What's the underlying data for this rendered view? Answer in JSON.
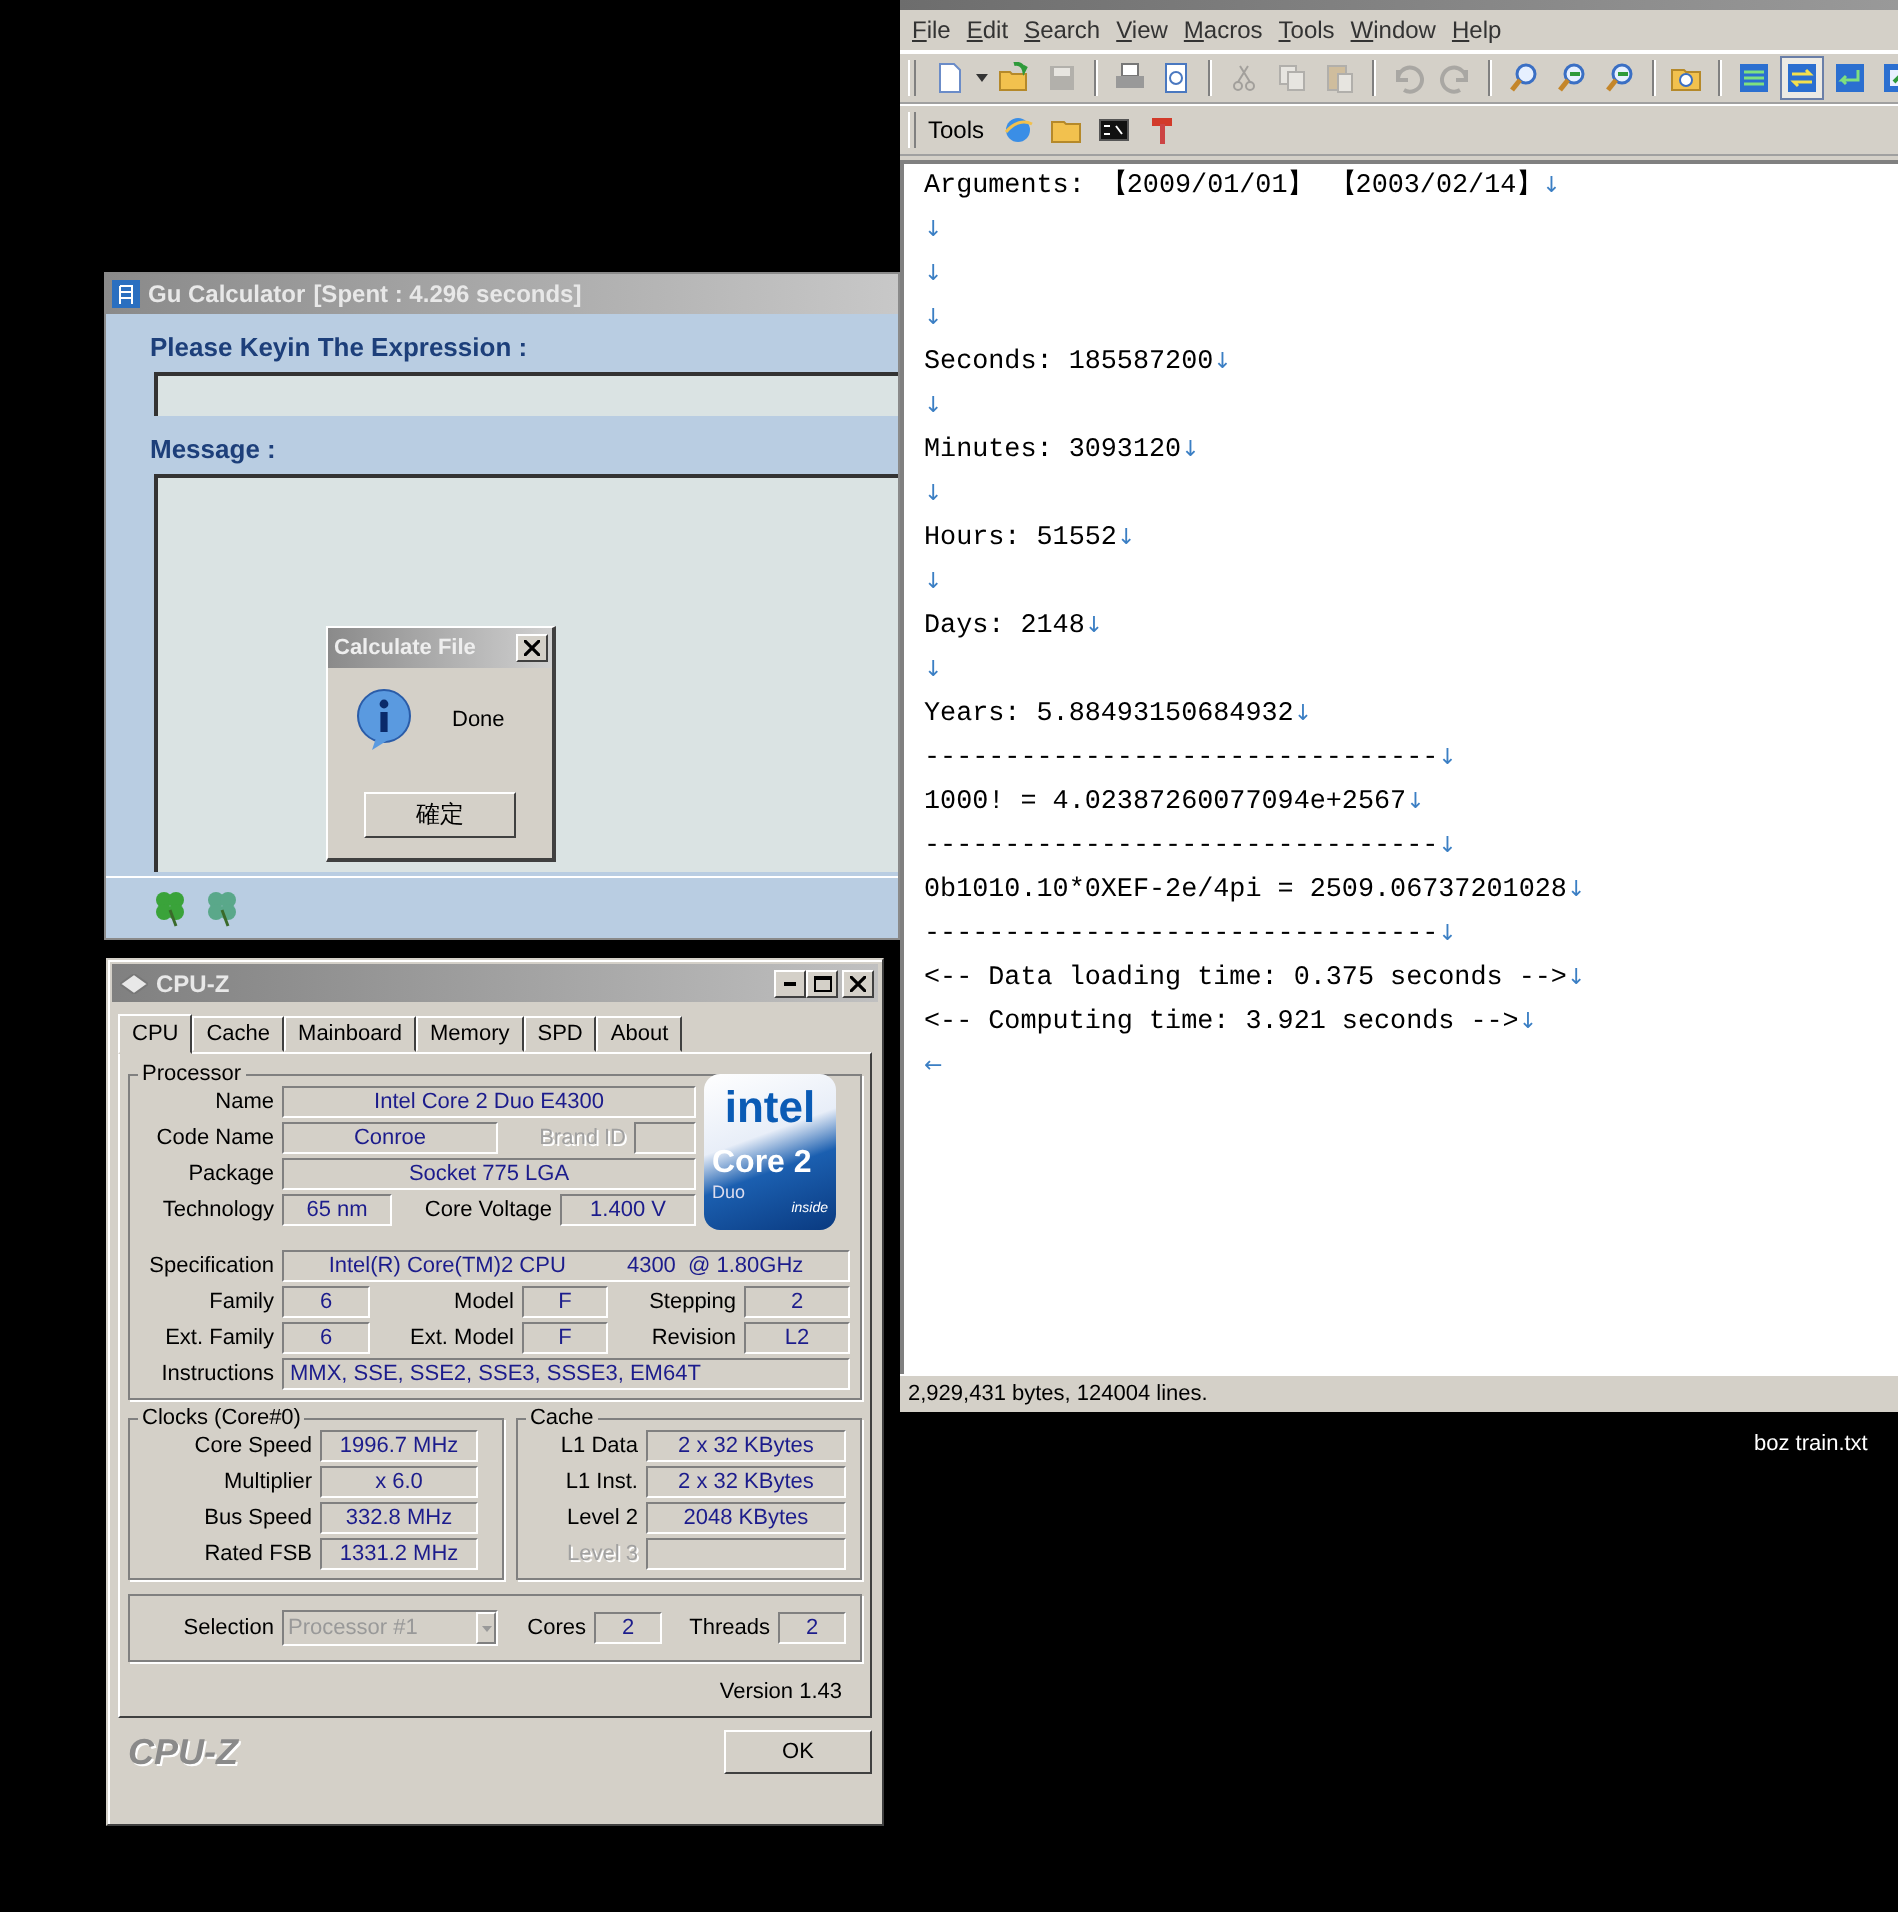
{
  "editor": {
    "menu": [
      "File",
      "Edit",
      "Search",
      "View",
      "Macros",
      "Tools",
      "Window",
      "Help"
    ],
    "toolbar": [
      {
        "pressed": false,
        "disabled": false
      },
      {
        "pressed": false,
        "disabled": false
      },
      {
        "pressed": false,
        "disabled": true
      },
      {
        "pressed": false,
        "disabled": false
      },
      {
        "pressed": false,
        "disabled": false
      },
      {
        "pressed": false,
        "disabled": true
      },
      {
        "pressed": false,
        "disabled": true
      },
      {
        "pressed": false,
        "disabled": true
      },
      {
        "pressed": false,
        "disabled": true
      },
      {
        "pressed": false,
        "disabled": true
      },
      {
        "pressed": false,
        "disabled": false
      },
      {
        "pressed": false,
        "disabled": false
      },
      {
        "pressed": false,
        "disabled": false
      },
      {
        "pressed": false,
        "disabled": false
      },
      {
        "pressed": false,
        "disabled": false
      },
      {
        "pressed": true,
        "disabled": false
      },
      {
        "pressed": false,
        "disabled": false
      },
      {
        "pressed": false,
        "disabled": false
      }
    ],
    "tools_label": "Tools",
    "lines": [
      {
        "text": "Arguments: 【2009/01/01】 【2003/02/14】",
        "end": "↓"
      },
      {
        "end": "↓"
      },
      {
        "end": "↓"
      },
      {
        "end": "↓"
      },
      {
        "text": "Seconds: 185587200",
        "end": "↓"
      },
      {
        "end": "↓"
      },
      {
        "text": "Minutes: 3093120",
        "end": "↓"
      },
      {
        "end": "↓"
      },
      {
        "text": "Hours: 51552",
        "end": "↓"
      },
      {
        "end": "↓"
      },
      {
        "text": "Days: 2148",
        "end": "↓"
      },
      {
        "end": "↓"
      },
      {
        "text": "Years: 5.88493150684932",
        "end": "↓"
      },
      {
        "text": "--------------------------------",
        "end": "↓"
      },
      {
        "text": "1000! = 4.02387260077094e+2567",
        "end": "↓"
      },
      {
        "text": "--------------------------------",
        "end": "↓"
      },
      {
        "text": "0b1010.10*0XEF-2e/4pi = 2509.06737201028",
        "end": "↓"
      },
      {
        "text": "--------------------------------",
        "end": "↓"
      },
      {
        "text": "<-- Data loading time: 0.375 seconds -->",
        "end": "↓"
      },
      {
        "text": "<-- Computing time: 3.921 seconds -->",
        "end": "↓"
      },
      {
        "end": "←"
      }
    ],
    "status": "2,929,431 bytes, 124004 lines."
  },
  "desktop_icon": {
    "label": "boz train.txt"
  },
  "gu_calculator": {
    "title": "Gu Calculator",
    "spent": "[Spent : 4.296 seconds]",
    "expression_label": "Please Keyin The Expression :",
    "message_label": "Message :"
  },
  "dialog": {
    "title": "Calculate File",
    "message": "Done",
    "button": "確定"
  },
  "cpuz": {
    "title": "CPU-Z",
    "tabs": [
      {
        "label": "CPU",
        "selected": true
      },
      {
        "label": "Cache",
        "selected": false
      },
      {
        "label": "Mainboard",
        "selected": false
      },
      {
        "label": "Memory",
        "selected": false
      },
      {
        "label": "SPD",
        "selected": false
      },
      {
        "label": "About",
        "selected": false
      }
    ],
    "processor": {
      "legend": "Processor",
      "name": {
        "label": "Name",
        "value": "Intel Core 2 Duo E4300"
      },
      "code_name": {
        "label": "Code Name",
        "value": "Conroe"
      },
      "brand_id": {
        "label": "Brand ID",
        "disabled": true
      },
      "package": {
        "label": "Package",
        "value": "Socket 775 LGA"
      },
      "technology": {
        "label": "Technology",
        "value": "65 nm"
      },
      "core_voltage": {
        "label": "Core Voltage",
        "value": "1.400 V"
      },
      "specification": {
        "label": "Specification",
        "value": "Intel(R) Core(TM)2 CPU          4300  @ 1.80GHz"
      },
      "family": {
        "label": "Family",
        "value": "6"
      },
      "model": {
        "label": "Model",
        "value": "F"
      },
      "stepping": {
        "label": "Stepping",
        "value": "2"
      },
      "ext_family": {
        "label": "Ext. Family",
        "value": "6"
      },
      "ext_model": {
        "label": "Ext. Model",
        "value": "F"
      },
      "revision": {
        "label": "Revision",
        "value": "L2"
      },
      "instructions": {
        "label": "Instructions",
        "value": "MMX, SSE, SSE2, SSE3, SSSE3, EM64T"
      }
    },
    "logo": {
      "brand": "intel",
      "product": "Core 2",
      "series": "Duo",
      "tag": "inside"
    },
    "clocks": {
      "legend": "Clocks (Core#0)",
      "rows": [
        {
          "label": "Core Speed",
          "value": "1996.7 MHz"
        },
        {
          "label": "Multiplier",
          "value": "x 6.0"
        },
        {
          "label": "Bus Speed",
          "value": "332.8 MHz"
        },
        {
          "label": "Rated FSB",
          "value": "1331.2 MHz"
        }
      ]
    },
    "cache": {
      "legend": "Cache",
      "rows": [
        {
          "label": "L1 Data",
          "value": "2 x 32 KBytes",
          "disabled": false
        },
        {
          "label": "L1 Inst.",
          "value": "2 x 32 KBytes",
          "disabled": false
        },
        {
          "label": "Level 2",
          "value": "2048 KBytes",
          "disabled": false
        },
        {
          "label": "Level 3",
          "disabled": true
        }
      ]
    },
    "selection": {
      "label": "Selection",
      "value": "Processor #1",
      "disabled": true
    },
    "cores": {
      "label": "Cores",
      "value": "2"
    },
    "threads": {
      "label": "Threads",
      "value": "2"
    },
    "version": "Version 1.43",
    "brand": "CPU-Z",
    "ok": "OK"
  }
}
